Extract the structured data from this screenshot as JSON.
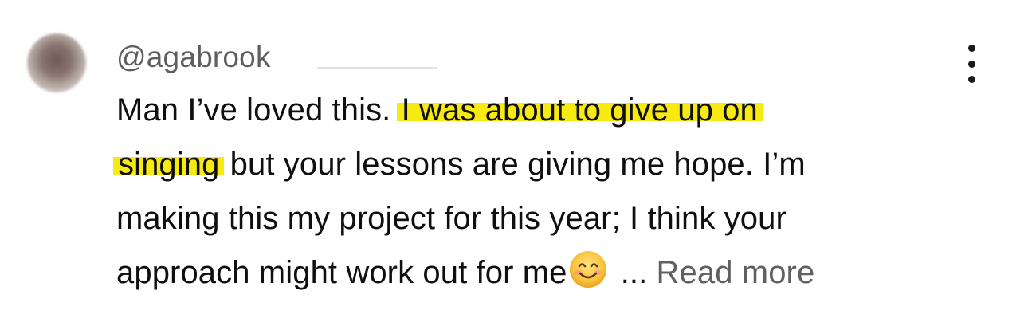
{
  "comment": {
    "username": "@agabrook",
    "text": {
      "line1_plain": "Man I’ve loved this. ",
      "line1_highlight": "I was about to give up on",
      "line2_highlight": "singing",
      "line2_plain": " but your lessons are giving me hope. I’m",
      "line3_plain": "making this my project for this year; I think your",
      "line4_plain": "approach might work out for me"
    },
    "emoji_icon": "smiling-face-emoji-icon",
    "ellipsis": " ...",
    "read_more_label": " Read more",
    "menu_icon": "more-vertical-icon",
    "highlight_color": "#f7ea10"
  }
}
